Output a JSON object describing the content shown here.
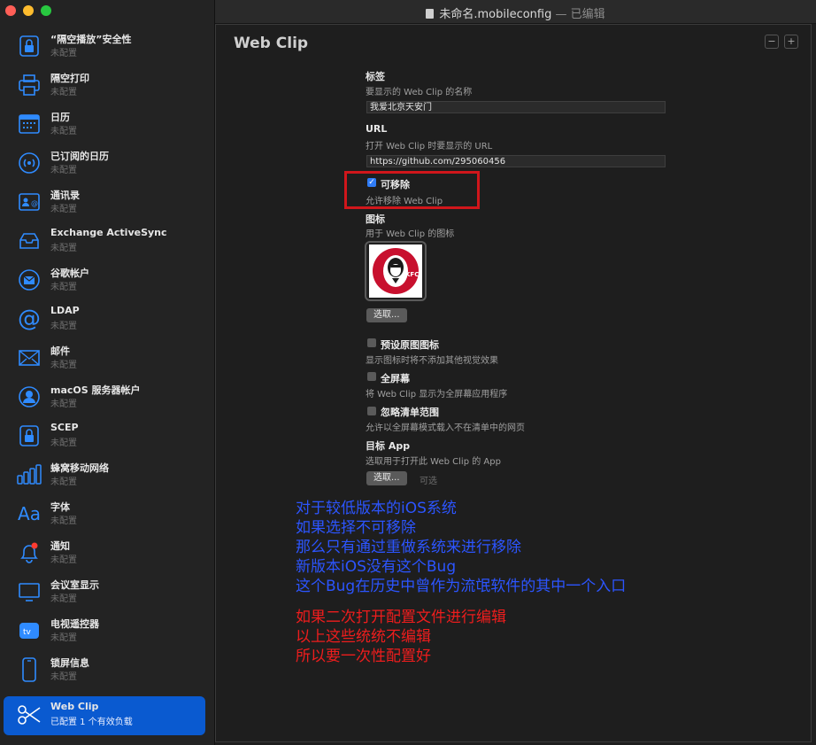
{
  "window": {
    "title": "未命名.mobileconfig",
    "separator": " — ",
    "edited": "已编辑"
  },
  "sidebar": {
    "items": [
      {
        "name": "“隔空播放”安全性",
        "status": "未配置",
        "icon": "lock-icon"
      },
      {
        "name": "隔空打印",
        "status": "未配置",
        "icon": "printer-icon"
      },
      {
        "name": "日历",
        "status": "未配置",
        "icon": "calendar-icon"
      },
      {
        "name": "已订阅的日历",
        "status": "未配置",
        "icon": "broadcast-icon"
      },
      {
        "name": "通讯录",
        "status": "未配置",
        "icon": "contacts-icon"
      },
      {
        "name": "Exchange ActiveSync",
        "status": "未配置",
        "icon": "exchange-icon"
      },
      {
        "name": "谷歌帐户",
        "status": "未配置",
        "icon": "mail-circle-icon"
      },
      {
        "name": "LDAP",
        "status": "未配置",
        "icon": "at-icon"
      },
      {
        "name": "邮件",
        "status": "未配置",
        "icon": "mail-icon"
      },
      {
        "name": "macOS 服务器帐户",
        "status": "未配置",
        "icon": "user-icon"
      },
      {
        "name": "SCEP",
        "status": "未配置",
        "icon": "lock-icon"
      },
      {
        "name": "蜂窝移动网络",
        "status": "未配置",
        "icon": "signal-bars-icon"
      },
      {
        "name": "字体",
        "status": "未配置",
        "icon": "font-icon"
      },
      {
        "name": "通知",
        "status": "未配置",
        "icon": "bell-icon"
      },
      {
        "name": "会议室显示",
        "status": "未配置",
        "icon": "display-icon"
      },
      {
        "name": "电视遥控器",
        "status": "未配置",
        "icon": "appletv-icon"
      },
      {
        "name": "锁屏信息",
        "status": "未配置",
        "icon": "phone-icon"
      },
      {
        "name": "Web Clip",
        "status": "已配置 1 个有效负载",
        "icon": "scissors-icon",
        "selected": true
      }
    ]
  },
  "panel": {
    "heading": "Web Clip",
    "minus": "−",
    "plus": "+",
    "label_title": "标签",
    "label_desc": "要显示的 Web Clip 的名称",
    "label_value": "我爱北京天安门",
    "url_title": "URL",
    "url_desc": "打开 Web Clip 时要显示的 URL",
    "url_value": "https://github.com/295060456",
    "removable_title": "可移除",
    "removable_desc": "允许移除 Web Clip",
    "removable_checked": true,
    "icon_title": "图标",
    "icon_desc": "用于 Web Clip 的图标",
    "icon_logo_text": "KFC",
    "choose_label": "选取...",
    "precomposed_title": "预设原图图标",
    "precomposed_desc": "显示图标时将不添加其他视觉效果",
    "fullscreen_title": "全屏幕",
    "fullscreen_desc": "将 Web Clip 显示为全屏幕应用程序",
    "ignore_scope_title": "忽略清单范围",
    "ignore_scope_desc": "允许以全屏幕模式载入不在清单中的网页",
    "target_app_title": "目标 App",
    "target_app_desc": "选取用于打开此 Web Clip 的 App",
    "target_choose_label": "选取...",
    "optional_label": "可选"
  },
  "annotations": {
    "blue": [
      "对于较低版本的iOS系统",
      "如果选择不可移除",
      "那么只有通过重做系统来进行移除",
      "新版本iOS没有这个Bug",
      "这个Bug在历史中曾作为流氓软件的其中一个入口"
    ],
    "red": [
      "如果二次打开配置文件进行编辑",
      "以上这些统统不编辑",
      "所以要一次性配置好"
    ]
  },
  "colors": {
    "accent": "#0a5ad0",
    "annotation_blue": "#2c55ff",
    "annotation_red": "#ee1d1d",
    "highlight_box": "#d0161b"
  }
}
